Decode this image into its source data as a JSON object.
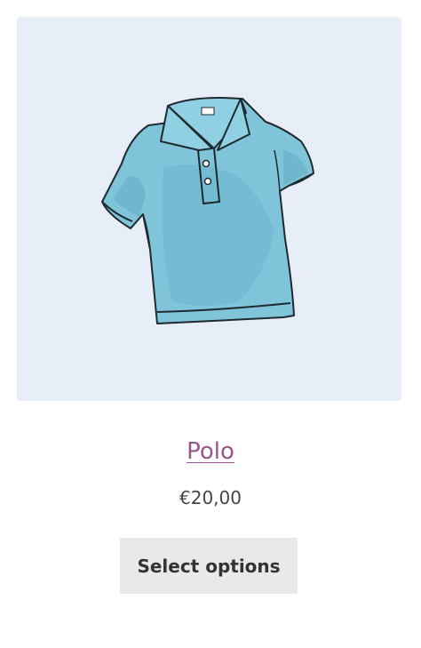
{
  "product": {
    "image_icon": "polo-shirt-illustration",
    "title": "Polo",
    "price": "€20,00",
    "button_label": "Select options"
  },
  "colors": {
    "image_background": "#e8eef7",
    "shirt_fill": "#7fc4d9",
    "title_link": "#96588a",
    "price_text": "#43454b",
    "button_background": "#e9e9e9",
    "button_text": "#333333"
  }
}
